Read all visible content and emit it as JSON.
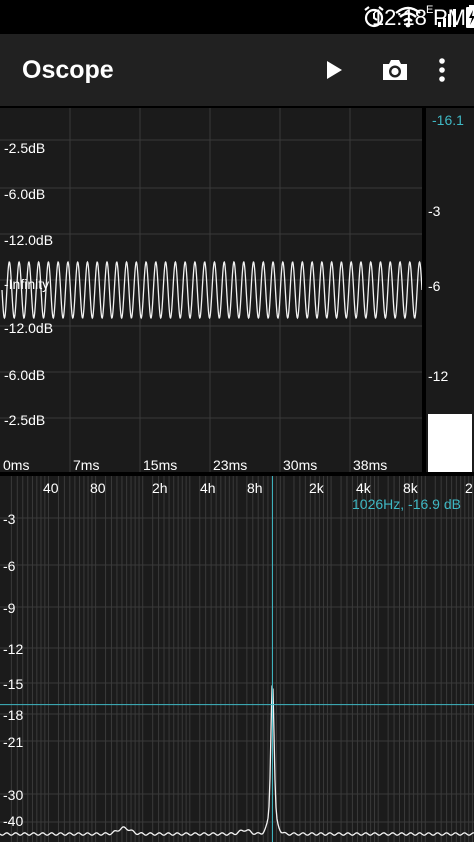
{
  "status_bar": {
    "time": "12:18 PM",
    "network_letter": "E",
    "icons": [
      "alarm-icon",
      "wifi-icon",
      "signal-icon",
      "battery-charging-icon"
    ]
  },
  "app_bar": {
    "title": "Oscope",
    "actions": [
      "play-icon",
      "camera-icon",
      "overflow-menu-icon"
    ]
  },
  "scope": {
    "y_labels_top": [
      "-2.5dB",
      "-6.0dB",
      "-12.0dB"
    ],
    "center_label": "-Infinity",
    "y_labels_bottom": [
      "-12.0dB",
      "-6.0dB",
      "-2.5dB"
    ],
    "x_labels": [
      "0ms",
      "7ms",
      "15ms",
      "23ms",
      "30ms",
      "38ms"
    ],
    "waveform_cycles": 43
  },
  "level_meter": {
    "readout": "-16.1",
    "ticks": [
      "-3",
      "-6",
      "-12"
    ],
    "level_fraction": 0.16
  },
  "spectrum": {
    "x_labels": [
      "40",
      "80",
      "2h",
      "4h",
      "8h",
      "2k",
      "4k",
      "8k",
      "2"
    ],
    "y_labels": [
      "-3",
      "-6",
      "-9",
      "-12",
      "-15",
      "-18",
      "-21",
      "-30",
      "-40"
    ],
    "cursor_readout": "1026Hz, -16.9 dB",
    "peak_hz": 1026,
    "peak_db": -16.9
  },
  "colors": {
    "accent": "#3fb8c4",
    "panel": "#1b1b1b",
    "app_bar": "#212121",
    "grid": "#3a3a3a"
  }
}
